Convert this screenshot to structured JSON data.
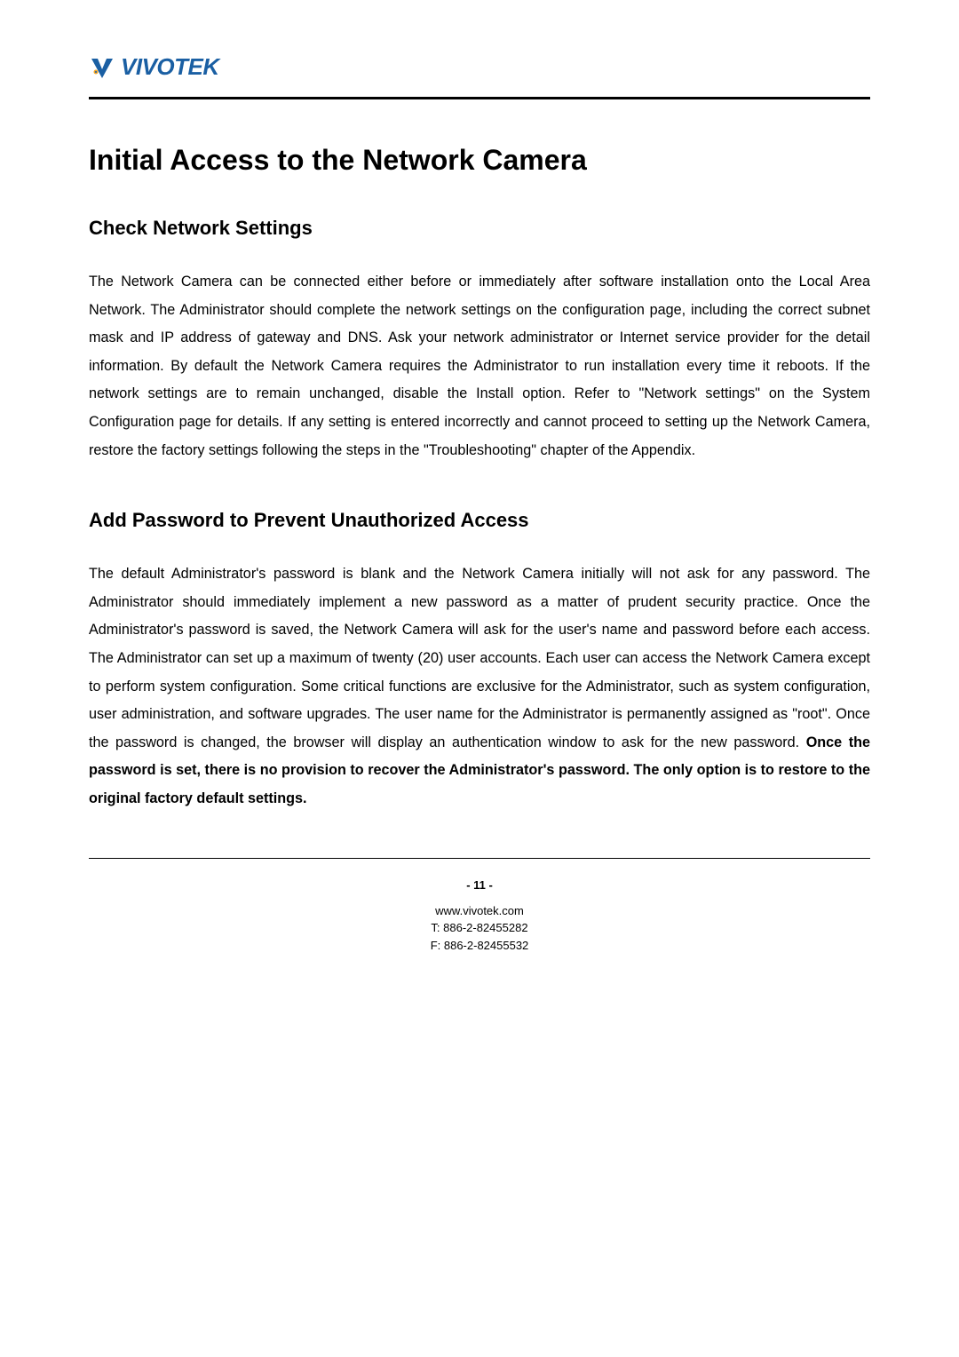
{
  "logo": {
    "brand": "VIVOTEK"
  },
  "heading_main": "Initial Access to the Network Camera",
  "section1": {
    "heading": "Check Network Settings",
    "body": "The Network Camera can be connected either before or immediately after software installation onto the Local Area Network. The Administrator should complete the network settings on the configuration page, including the correct subnet mask and IP address of gateway and DNS. Ask your network administrator or Internet service provider for the detail information. By default the Network Camera requires the Administrator to run installation every time it reboots. If the network settings are to remain unchanged, disable the Install option. Refer to \"Network settings\" on the System Configuration page for details. If any setting is entered incorrectly and cannot proceed to setting up the Network Camera, restore the factory settings following the steps in the \"Troubleshooting\" chapter of the Appendix."
  },
  "section2": {
    "heading": "Add Password to Prevent Unauthorized Access",
    "body_part1": "The default Administrator's password is blank and the Network Camera initially will not ask for any password. The Administrator should immediately implement a new password as a matter of prudent security practice. Once the Administrator's password is saved, the Network Camera will ask for the user's name and password before each access. The Administrator can set up a maximum of twenty (20) user accounts. Each user can access the Network Camera except to perform system configuration. Some critical functions are exclusive for the Administrator, such as system configuration, user administration, and software upgrades. The user name for the Administrator is permanently assigned as \"root\". Once the password is changed, the browser will display an authentication window to ask for the new password.  ",
    "body_bold": "Once the password is set, there is no provision to recover the Administrator's password.  The only option is to restore to the original factory default settings."
  },
  "page_number": "- 11 -",
  "footer": {
    "website": "www.vivotek.com",
    "tel": "T: 886-2-82455282",
    "fax": "F: 886-2-82455532"
  }
}
